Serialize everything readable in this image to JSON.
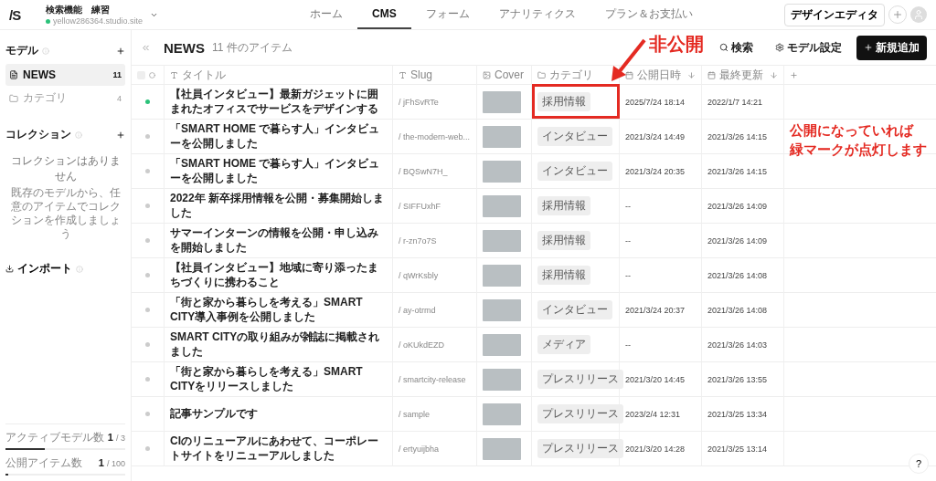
{
  "header": {
    "logo": "/S",
    "site_name": "検索機能　練習",
    "site_url": "yellow286364.studio.site",
    "nav": [
      {
        "label": "ホーム",
        "selected": false
      },
      {
        "label": "CMS",
        "selected": true
      },
      {
        "label": "フォーム",
        "selected": false
      },
      {
        "label": "アナリティクス",
        "selected": false
      },
      {
        "label": "プラン＆お支払い",
        "selected": false
      }
    ],
    "design_editor": "デザインエディタ"
  },
  "sidebar": {
    "models_title": "モデル",
    "models": [
      {
        "name": "NEWS",
        "count": "11",
        "kind": "document",
        "selected": true
      },
      {
        "name": "カテゴリ",
        "count": "4",
        "kind": "folder",
        "selected": false
      }
    ],
    "collections_title": "コレクション",
    "collections_empty": "コレクションはありません",
    "collections_hint": "既存のモデルから、任意のアイテムでコレクションを作成しましょう",
    "import": "インポート",
    "usage": [
      {
        "label": "アクティブモデル数",
        "used": "1",
        "limit": "/ 3",
        "level": 0.33
      },
      {
        "label": "公開アイテム数",
        "used": "1",
        "limit": "/ 100",
        "level": 0.01
      }
    ]
  },
  "main": {
    "select_all_checked": false,
    "title": "NEWS",
    "count": "11 件のアイテム",
    "actions": [
      {
        "label": "検索",
        "kind": "search"
      },
      {
        "label": "モデル設定",
        "kind": "settings"
      },
      {
        "label": "新規追加",
        "kind": "add"
      }
    ],
    "columns": [
      {
        "label": "タイトル",
        "kind": "text",
        "sortable": false
      },
      {
        "label": "Slug",
        "kind": "text",
        "sortable": false
      },
      {
        "label": "Cover",
        "kind": "image",
        "sortable": false
      },
      {
        "label": "カテゴリ",
        "kind": "folder",
        "sortable": false
      },
      {
        "label": "公開日時",
        "kind": "date",
        "sortable": true
      },
      {
        "label": "最終更新",
        "kind": "date",
        "sortable": true
      }
    ],
    "rows": [
      {
        "published": true,
        "title": "【社員インタビュー】最新ガジェットに囲まれたオフィスでサービスをデザインする",
        "slug": "/ jFhSvRTe",
        "category": "採用情報",
        "published_at": "2025/7/24 18:14",
        "updated_at": "2022/1/7 14:21"
      },
      {
        "published": false,
        "title": "「SMART HOME で暮らす人」インタビューを公開しました",
        "slug": "/ the-modern-web...",
        "category": "インタビュー",
        "published_at": "2021/3/24 14:49",
        "updated_at": "2021/3/26 14:15"
      },
      {
        "published": false,
        "title": "「SMART HOME で暮らす人」インタビューを公開しました",
        "slug": "/ BQSwN7H_",
        "category": "インタビュー",
        "published_at": "2021/3/24 20:35",
        "updated_at": "2021/3/26 14:15"
      },
      {
        "published": false,
        "title": "2022年 新卒採用情報を公開・募集開始しました",
        "slug": "/ SIFFUxhF",
        "category": "採用情報",
        "published_at": "--",
        "updated_at": "2021/3/26 14:09"
      },
      {
        "published": false,
        "title": "サマーインターンの情報を公開・申し込みを開始しました",
        "slug": "/ r-zn7o7S",
        "category": "採用情報",
        "published_at": "--",
        "updated_at": "2021/3/26 14:09"
      },
      {
        "published": false,
        "title": "【社員インタビュー】地域に寄り添ったまちづくりに携わること",
        "slug": "/ qWrKsbly",
        "category": "採用情報",
        "published_at": "--",
        "updated_at": "2021/3/26 14:08"
      },
      {
        "published": false,
        "title": "「街と家から暮らしを考える」SMART CITY導入事例を公開しました",
        "slug": "/ ay-otrmd",
        "category": "インタビュー",
        "published_at": "2021/3/24 20:37",
        "updated_at": "2021/3/26 14:08"
      },
      {
        "published": false,
        "title": "SMART CITYの取り組みが雑誌に掲載されました",
        "slug": "/ oKUkdEZD",
        "category": "メディア",
        "published_at": "--",
        "updated_at": "2021/3/26 14:03"
      },
      {
        "published": false,
        "title": "「街と家から暮らしを考える」SMART CITYをリリースしました",
        "slug": "/ smartcity-release",
        "category": "プレスリリース",
        "published_at": "2021/3/20 14:45",
        "updated_at": "2021/3/26 13:55"
      },
      {
        "published": false,
        "title": "記事サンプルです",
        "slug": "/ sample",
        "category": "プレスリリース",
        "published_at": "2023/2/4 12:31",
        "updated_at": "2021/3/25 13:34"
      },
      {
        "published": false,
        "title": "CIのリニューアルにあわせて、コーポレートサイトをリニューアルしました",
        "slug": "/ ertyuijbha",
        "category": "プレスリリース",
        "published_at": "2021/3/20 14:28",
        "updated_at": "2021/3/25 13:14"
      }
    ]
  },
  "annotations": {
    "private_label": "非公開",
    "public_note": [
      "公開になっていれば",
      "緑マークが点灯します"
    ]
  },
  "help": "?"
}
